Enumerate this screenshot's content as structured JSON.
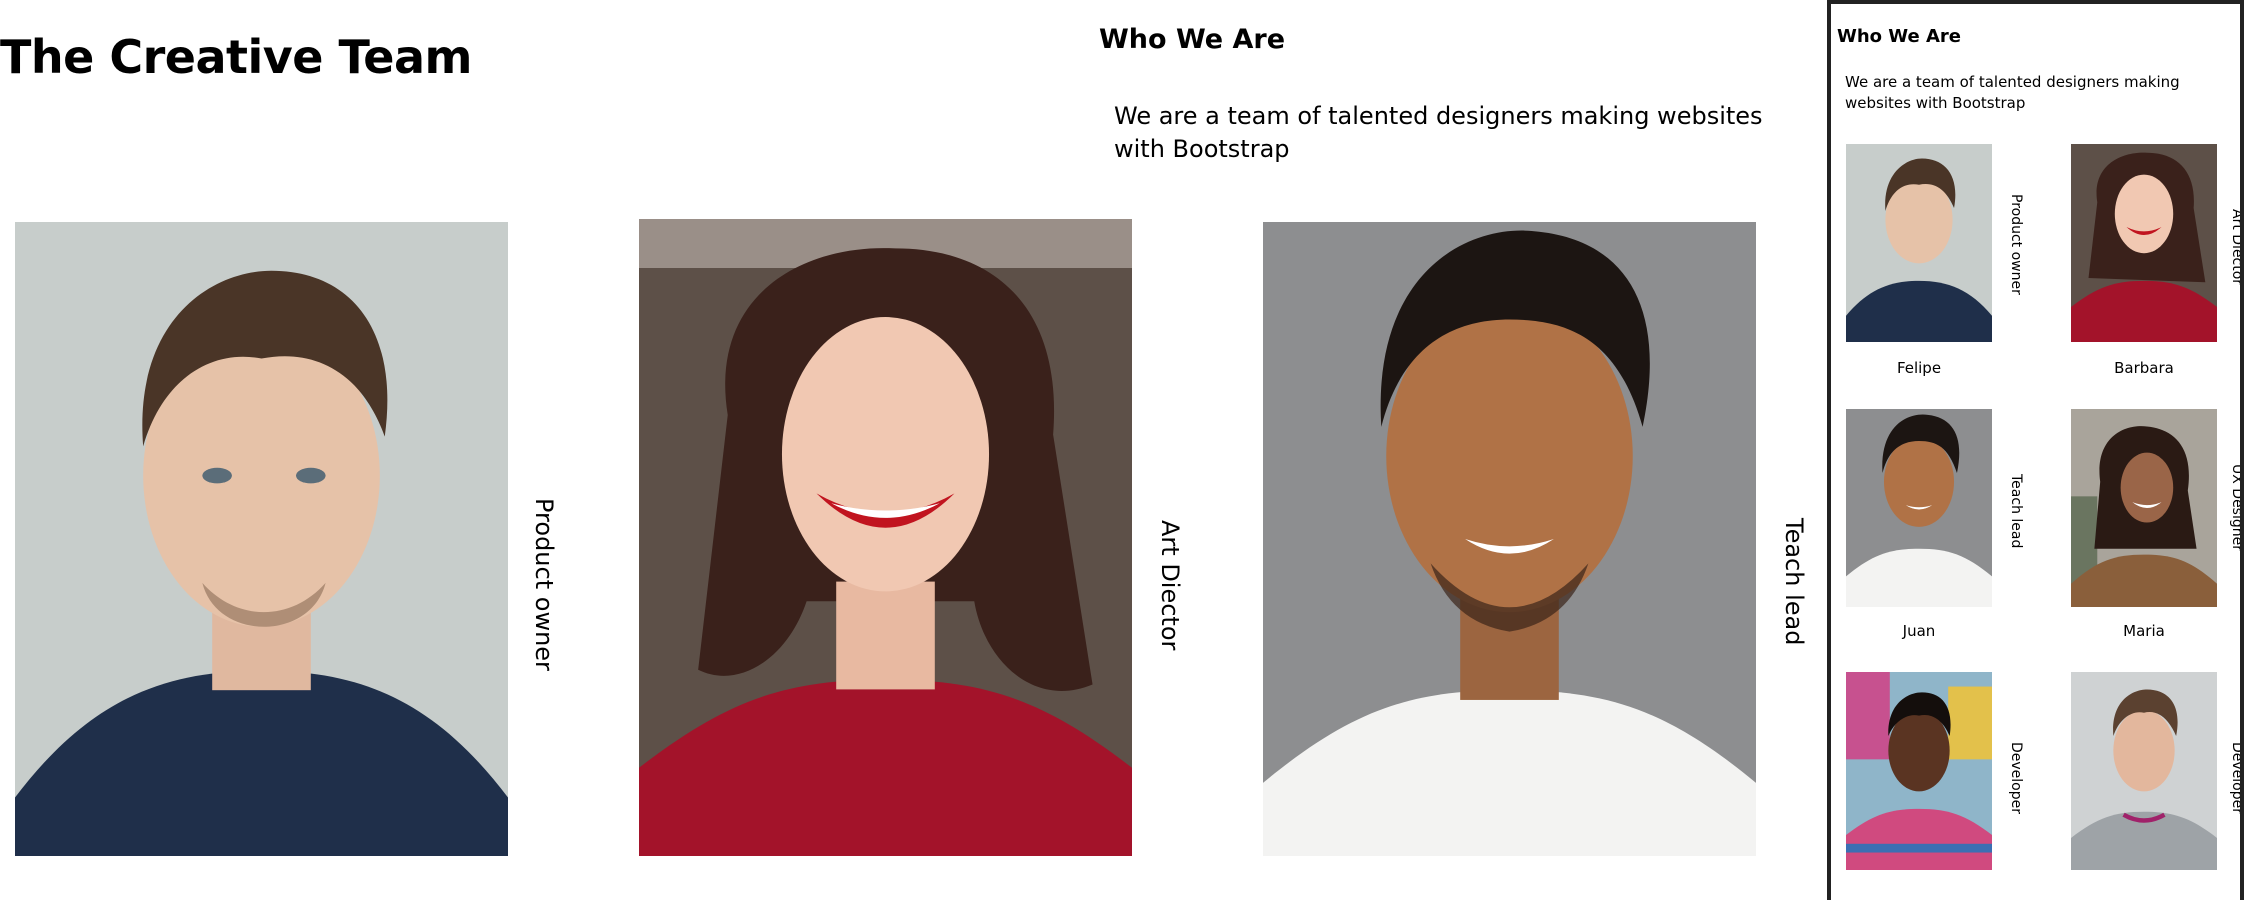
{
  "page": {
    "title": "The Creative Team",
    "who_heading": "Who We Are",
    "who_text": "We are a team of talented designers making websites with Bootstrap"
  },
  "team": [
    {
      "name": "Felipe",
      "role": "Product owner",
      "photo": "man-blue-shirt-photo",
      "colors": {
        "bg": "#c7cdcb",
        "shirt": "#1f2f4a",
        "skin": "#e6c2a8",
        "hair": "#4a3527"
      }
    },
    {
      "name": "Barbara",
      "role": "Art Diector",
      "photo": "woman-red-sweater-photo",
      "colors": {
        "bg": "#5d5048",
        "shirt": "#a3132a",
        "skin": "#f1c8b2",
        "hair": "#3a211b"
      }
    },
    {
      "name": "Juan",
      "role": "Teach lead",
      "photo": "man-white-tshirt-photo",
      "colors": {
        "bg": "#8d8e90",
        "shirt": "#f3f3f2",
        "skin": "#b07246",
        "hair": "#1c1512"
      }
    },
    {
      "name": "Maria",
      "role": "UX Designer",
      "photo": "woman-curly-hair-photo",
      "colors": {
        "bg": "#a9a49b",
        "shirt": "#8a5f3b",
        "skin": "#9a6548",
        "hair": "#2a1a14"
      }
    },
    {
      "name": "",
      "role": "Developer",
      "photo": "man-colorful-shirt-photo",
      "colors": {
        "bg": "#8fb5c9",
        "shirt": "#d04a7f",
        "skin": "#5a3422",
        "hair": "#140e0c"
      }
    },
    {
      "name": "",
      "role": "Developer",
      "photo": "man-grey-sweater-photo",
      "colors": {
        "bg": "#cfd2d3",
        "shirt": "#9ea3a7",
        "skin": "#e3b79d",
        "hair": "#5b4130"
      }
    }
  ],
  "sidebar": {
    "heading": "Who We Are",
    "text": "We are a team of talented designers making websites with Bootstrap"
  }
}
